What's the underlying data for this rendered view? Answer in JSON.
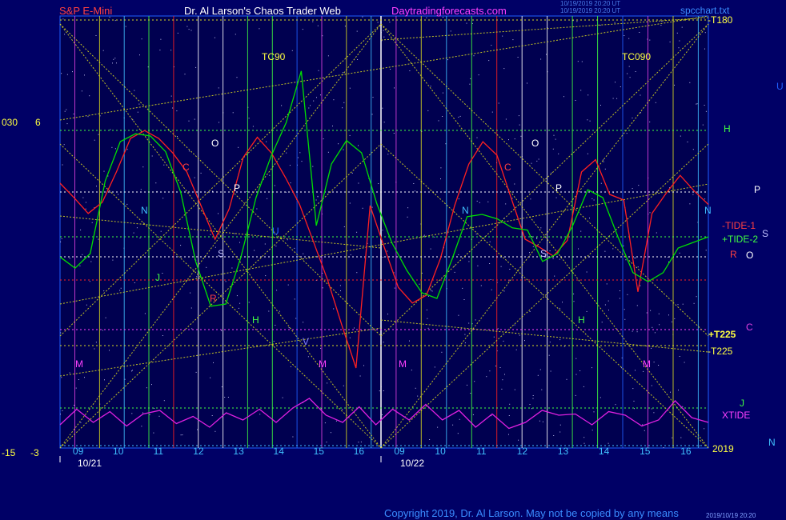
{
  "header": {
    "symbol": "S&P E-Mini",
    "author": "Dr. Al Larson's Chaos Trader Web",
    "site": "Daytradingforecasts.com",
    "stamp_line1": "10/19/2019 20:20 UT",
    "stamp_line2": "10/19/2019 20:20 UT",
    "file": "spcchart.txt"
  },
  "footer": {
    "copyright": "Copyright 2019, Dr. Al Larson. May not be copied by any means",
    "stamp": "2019/10/19 20:20"
  },
  "scale": {
    "upper_left": "030",
    "upper": "6",
    "lower_left": "-15",
    "lower": "-3"
  },
  "right_labels": {
    "t180": "-T180",
    "h": "H",
    "u": "U",
    "p": "P",
    "tide1": "-TIDE-1",
    "tide2": "+TIDE-2",
    "s": "S",
    "r": "R",
    "o": "O",
    "t225p": "+T225",
    "c": "C",
    "t225m": "-T225",
    "j": "J",
    "xtide": "XTIDE",
    "year": "2019",
    "n": "N"
  },
  "chart_labels": {
    "tc90": "TC90",
    "tc090": "TC090",
    "left": {
      "c": "C",
      "o": "O",
      "p": "P",
      "n": "N",
      "s": "S",
      "h": "H",
      "m": "M",
      "u": "U",
      "r": "R",
      "j": "J",
      "v": "V"
    },
    "right": {
      "c": "C",
      "o": "O",
      "p": "P",
      "n": "N",
      "s": "S",
      "h": "H",
      "m": "M"
    }
  },
  "chart_data": {
    "type": "line",
    "title": "S&P E-Mini",
    "dates": [
      "10/21",
      "10/22"
    ],
    "hour_ticks": {
      "day1": [
        "09",
        "10",
        "11",
        "12",
        "13",
        "14",
        "15",
        "16"
      ],
      "day2": [
        "09",
        "10",
        "11",
        "12",
        "13",
        "14",
        "15",
        "16"
      ]
    },
    "colors": {
      "tide1": "#ff2020",
      "tide2": "#00e000",
      "xtide": "#e020e0",
      "grid": "#d8d820",
      "accent": "#ffff00"
    },
    "series": [
      {
        "name": "-TIDE-1",
        "color": "#ff2020",
        "values": [
          0.45,
          0.32,
          0.18,
          0.28,
          0.55,
          0.85,
          0.92,
          0.85,
          0.72,
          0.55,
          0.25,
          -0.05,
          0.22,
          0.68,
          0.86,
          0.72,
          0.5,
          0.26,
          -0.08,
          -0.42,
          -0.82,
          -1.2,
          0.25,
          -0.12,
          -0.48,
          -0.62,
          -0.55,
          -0.22,
          0.25,
          0.62,
          0.82,
          0.7,
          0.32,
          -0.05,
          -0.12,
          -0.2,
          -0.06,
          0.55,
          0.66,
          0.35,
          0.3,
          -0.52,
          0.18,
          0.36,
          0.52,
          0.38,
          0.26
        ]
      },
      {
        "name": "+TIDE-2",
        "color": "#00e000",
        "values": [
          -0.18,
          -0.28,
          -0.15,
          0.5,
          0.85,
          0.92,
          0.9,
          0.76,
          0.4,
          -0.22,
          -0.62,
          -0.6,
          -0.18,
          0.35,
          0.72,
          1.02,
          1.48,
          0.1,
          0.65,
          0.86,
          0.75,
          0.3,
          -0.05,
          -0.3,
          -0.5,
          -0.55,
          -0.2,
          0.18,
          0.2,
          0.16,
          0.08,
          0.06,
          -0.22,
          -0.15,
          0.1,
          0.42,
          0.35,
          0.0,
          -0.32,
          -0.4,
          -0.32,
          -0.1,
          -0.05,
          0.0
        ]
      },
      {
        "name": "XTIDE",
        "color": "#e020e0",
        "values": [
          -0.3,
          0.35,
          -0.2,
          0.25,
          -0.35,
          0.15,
          0.3,
          -0.25,
          0.05,
          -0.4,
          0.2,
          -0.1,
          0.35,
          -0.2,
          0.4,
          0.8,
          0.1,
          -0.2,
          0.45,
          -0.3,
          0.35,
          -0.1,
          0.55,
          -0.1,
          0.3,
          -0.4,
          0.15,
          -0.45,
          -0.2,
          0.3,
          0.1,
          0.15,
          -0.3,
          0.25,
          0.1,
          -0.35,
          -0.1,
          0.7,
          0.0,
          -0.2
        ]
      }
    ]
  }
}
